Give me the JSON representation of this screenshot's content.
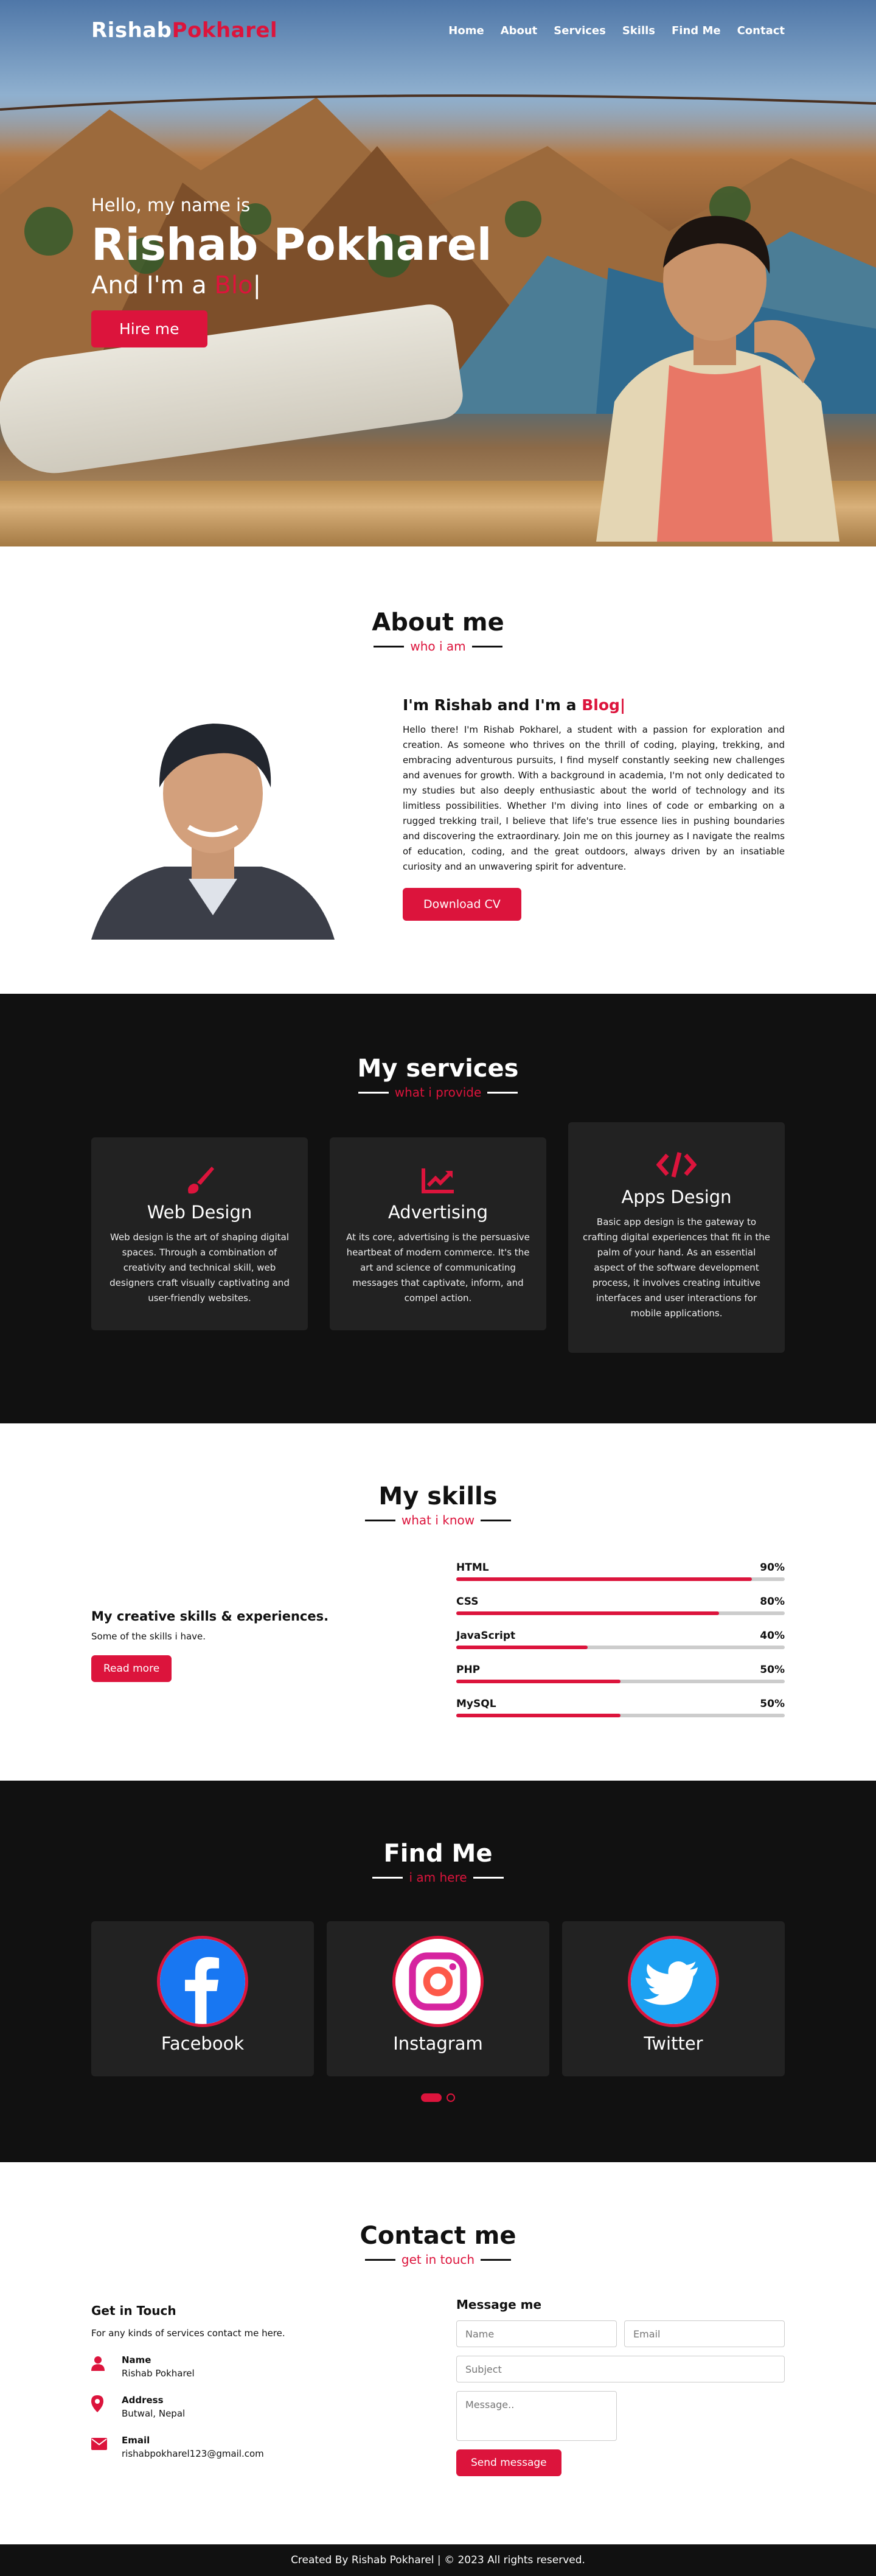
{
  "nav": {
    "logo_first": "Rishab",
    "logo_last": "Pokharel",
    "links": [
      "Home",
      "About",
      "Services",
      "Skills",
      "Find Me",
      "Contact"
    ]
  },
  "hero": {
    "greeting": "Hello, my name is",
    "name": "Rishab Pokharel",
    "role_prefix": "And I'm a",
    "role_typed": "Blo",
    "cursor": "|",
    "button": "Hire me"
  },
  "about": {
    "title": "About me",
    "subtitle": "who i am",
    "heading_prefix": "I'm Rishab and I'm a",
    "heading_typed": "Blog|",
    "body": "Hello there! I'm Rishab Pokharel, a student with a passion for exploration and creation. As someone who thrives on the thrill of coding, playing, trekking, and embracing adventurous pursuits, I find myself constantly seeking new challenges and avenues for growth. With a background in academia, I'm not only dedicated to my studies but also deeply enthusiastic about the world of technology and its limitless possibilities. Whether I'm diving into lines of code or embarking on a rugged trekking trail, I believe that life's true essence lies in pushing boundaries and discovering the extraordinary. Join me on this journey as I navigate the realms of education, coding, and the great outdoors, always driven by an insatiable curiosity and an unwavering spirit for adventure.",
    "button": "Download CV"
  },
  "services": {
    "title": "My services",
    "subtitle": "what i provide",
    "cards": [
      {
        "icon": "paintbrush-icon",
        "title": "Web Design",
        "text": "Web design is the art of shaping digital spaces. Through a combination of creativity and technical skill, web designers craft visually captivating and user-friendly websites."
      },
      {
        "icon": "chart-line-icon",
        "title": "Advertising",
        "text": "At its core, advertising is the persuasive heartbeat of modern commerce. It's the art and science of communicating messages that captivate, inform, and compel action."
      },
      {
        "icon": "code-icon",
        "title": "Apps Design",
        "text": "Basic app design is the gateway to crafting digital experiences that fit in the palm of your hand. As an essential aspect of the software development process, it involves creating intuitive interfaces and user interactions for mobile applications."
      }
    ]
  },
  "skills": {
    "title": "My skills",
    "subtitle": "what i know",
    "heading": "My creative skills & experiences.",
    "text": "Some of the skills i have.",
    "button": "Read more",
    "items": [
      {
        "name": "HTML",
        "label": "90%",
        "value": 0.9
      },
      {
        "name": "CSS",
        "label": "80%",
        "value": 0.8
      },
      {
        "name": "JavaScript",
        "label": "40%",
        "value": 0.4
      },
      {
        "name": "PHP",
        "label": "50%",
        "value": 0.5
      },
      {
        "name": "MySQL",
        "label": "50%",
        "value": 0.5
      }
    ]
  },
  "findme": {
    "title": "Find Me",
    "subtitle": "i am here",
    "socials": [
      "Facebook",
      "Instagram",
      "Twitter"
    ]
  },
  "contact": {
    "title": "Contact me",
    "subtitle": "get in touch",
    "left_heading": "Get in Touch",
    "lead": "For any kinds of services contact me here.",
    "info": [
      {
        "icon": "user-icon",
        "head": "Name",
        "value": "Rishab Pokharel"
      },
      {
        "icon": "map-marker-icon",
        "head": "Address",
        "value": "Butwal, Nepal"
      },
      {
        "icon": "envelope-icon",
        "head": "Email",
        "value": "rishabpokharel123@gmail.com"
      }
    ],
    "form_heading": "Message me",
    "placeholders": {
      "name": "Name",
      "email": "Email",
      "subject": "Subject",
      "message": "Message.."
    },
    "button": "Send message"
  },
  "footer": {
    "text": "Created By Rishab Pokharel | © 2023 All rights reserved."
  },
  "colors": {
    "accent": "#dc143c",
    "dark": "#111111",
    "card": "#222222"
  }
}
